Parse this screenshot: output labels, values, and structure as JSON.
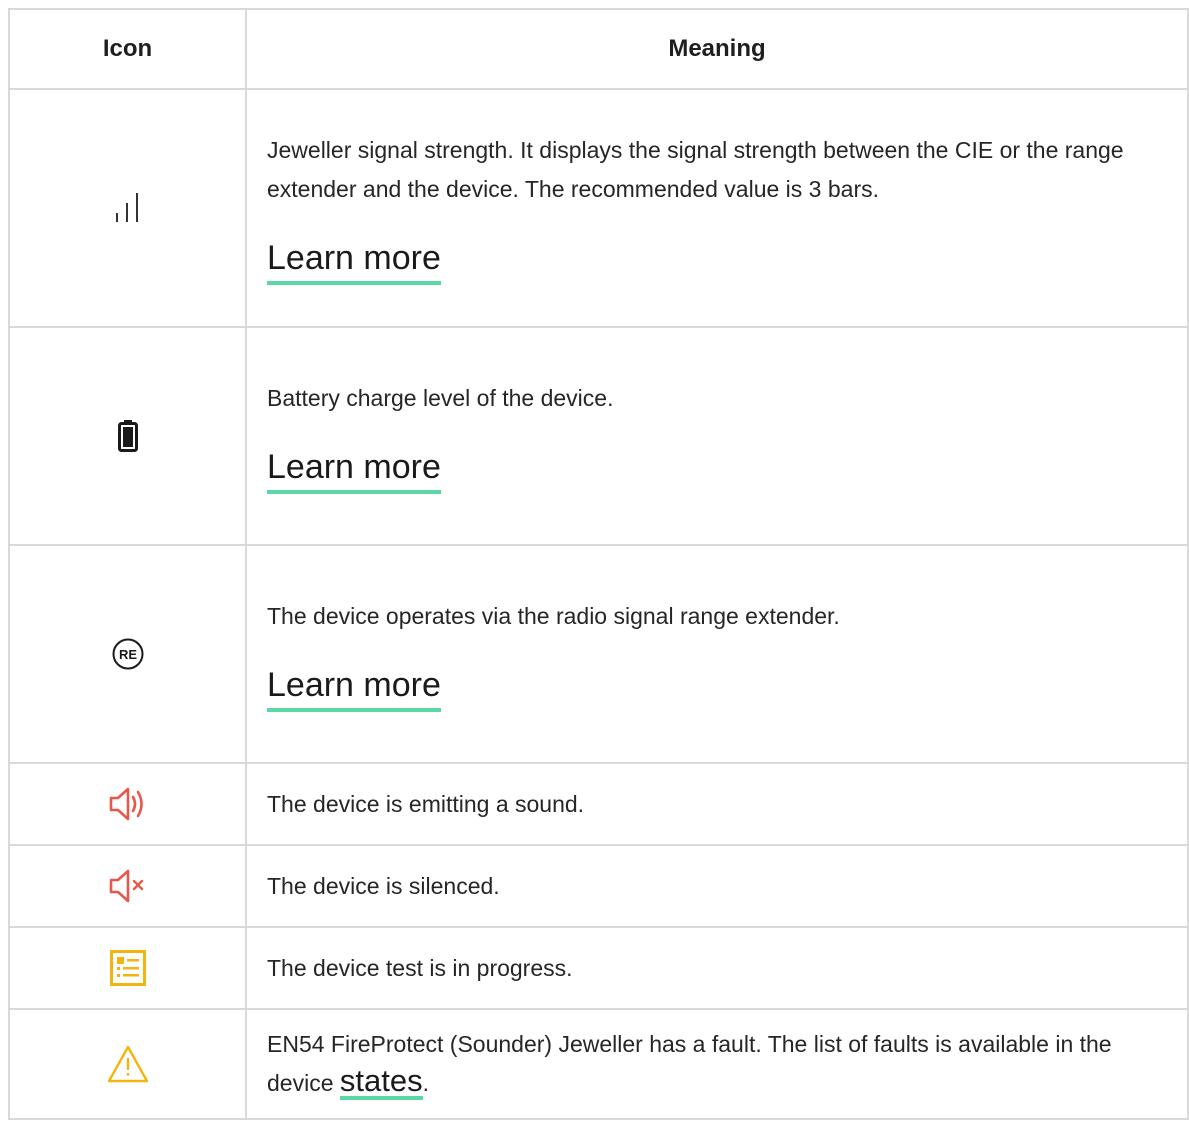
{
  "table": {
    "header_icon": "Icon",
    "header_meaning": "Meaning",
    "rows": [
      {
        "icon": "signal-strength-icon",
        "text": "Jeweller signal strength. It displays the signal strength between the CIE or the range extender and the device. The recommended value is 3 bars.",
        "link": "Learn more"
      },
      {
        "icon": "battery-icon",
        "text": "Battery charge level of the device.",
        "link": "Learn more"
      },
      {
        "icon": "range-extender-icon",
        "icon_text": "RE",
        "text": "The device operates via the radio signal range extender.",
        "link": "Learn more"
      },
      {
        "icon": "speaker-sound-icon",
        "text": "The device is emitting a sound."
      },
      {
        "icon": "speaker-muted-icon",
        "text": "The device is silenced."
      },
      {
        "icon": "test-list-icon",
        "text": "The device test is in progress."
      },
      {
        "icon": "warning-triangle-icon",
        "text_before": "EN54 FireProtect (Sounder) Jeweller has a fault. The list of faults is available in the device ",
        "link": "states",
        "text_after": "."
      }
    ]
  },
  "colors": {
    "border": "#d9d9d9",
    "link_underline": "#5ad7a3",
    "sound_red": "#e8584a",
    "test_yellow": "#f2b50d",
    "warning_yellow": "#f2b50d"
  }
}
